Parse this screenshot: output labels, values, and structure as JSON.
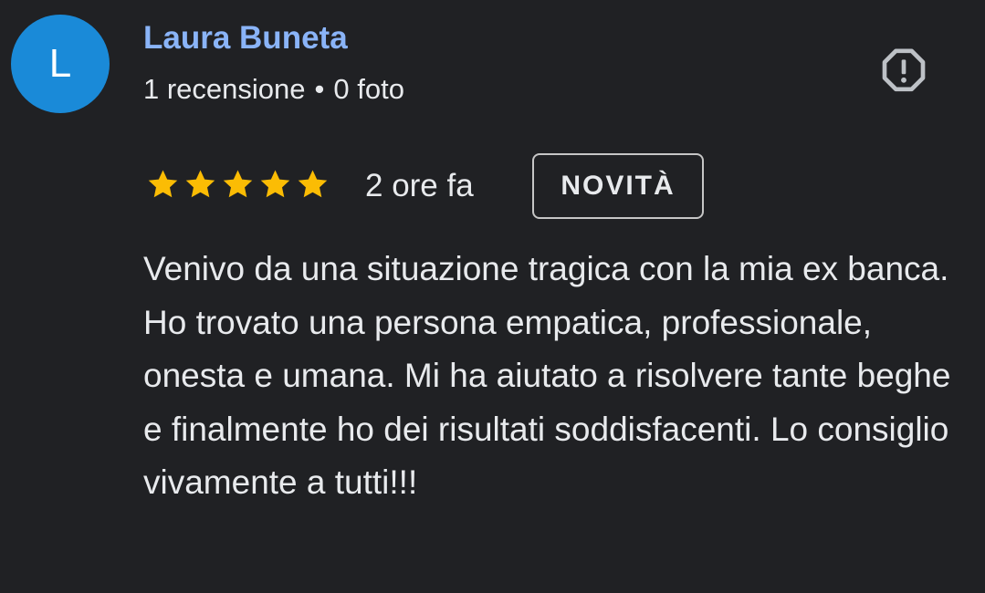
{
  "author": {
    "initial": "L",
    "name": "Laura Buneta",
    "reviews_count": "1 recensione",
    "separator": "•",
    "photos_count": "0 foto"
  },
  "review": {
    "rating": 5,
    "rating_max": 5,
    "time": "2 ore fa",
    "badge": "NOVITÀ",
    "text": "Venivo da una situazione tragica con la mia ex banca. Ho trovato una persona empatica, professionale, onesta e umana. Mi ha aiutato a risolvere tante beghe e finalmente ho dei risultati soddisfacenti. Lo consiglio vivamente a tutti!!!"
  },
  "icons": {
    "report": "report-octagon-icon",
    "star": "star-icon"
  },
  "colors": {
    "background": "#202124",
    "avatar": "#1a8ad8",
    "author_name": "#8ab4f8",
    "star": "#fbbc04",
    "text": "#e8eaed"
  }
}
